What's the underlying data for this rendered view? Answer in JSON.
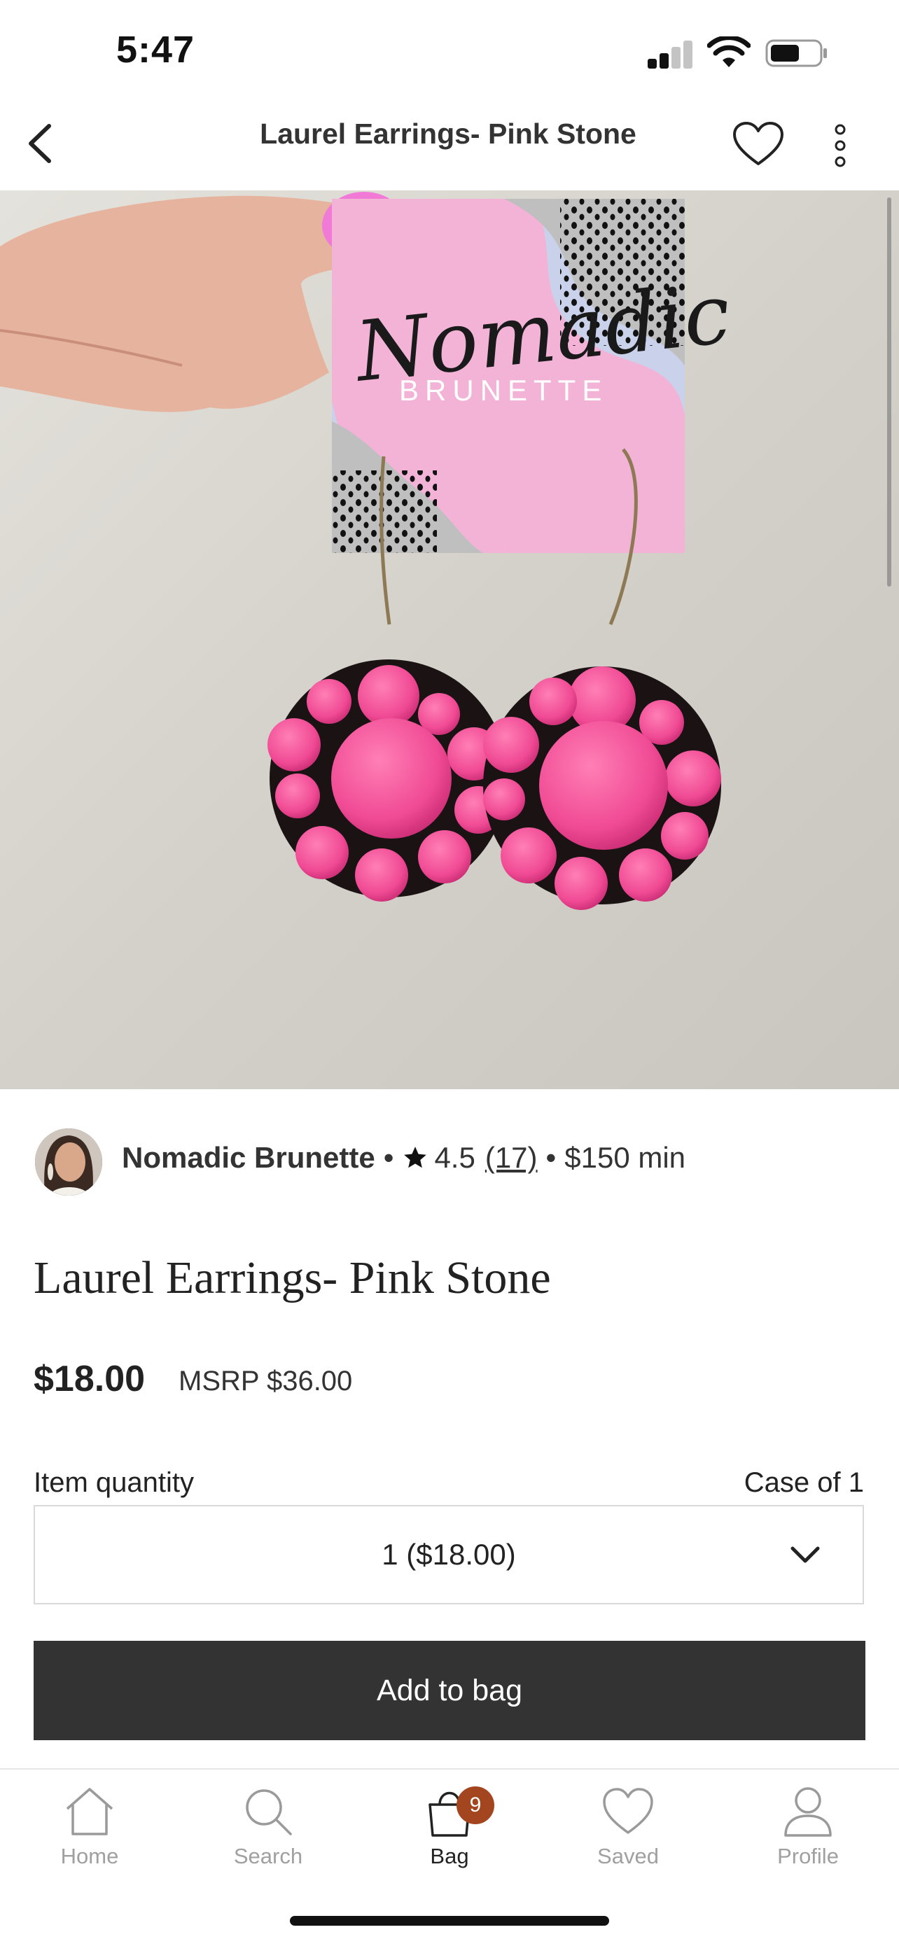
{
  "status_bar": {
    "time": "5:47"
  },
  "nav": {
    "title": "Laurel Earrings- Pink Stone"
  },
  "product_image": {
    "card_brand_script": "Nomadic",
    "card_brand_caps": "BRUNETTE"
  },
  "shop": {
    "name": "Nomadic Brunette",
    "separator": "•",
    "rating": "4.5",
    "review_count": "(17)",
    "minimum": "$150 min"
  },
  "product": {
    "title": "Laurel Earrings- Pink Stone",
    "price": "$18.00",
    "msrp": "MSRP $36.00"
  },
  "quantity": {
    "label": "Item quantity",
    "case_label": "Case of 1",
    "selected": "1 ($18.00)"
  },
  "actions": {
    "add_to_bag": "Add to bag"
  },
  "tabbar": {
    "items": [
      {
        "label": "Home"
      },
      {
        "label": "Search"
      },
      {
        "label": "Bag",
        "badge": "9"
      },
      {
        "label": "Saved"
      },
      {
        "label": "Profile"
      }
    ]
  },
  "colors": {
    "button_bg": "#333333",
    "badge_bg": "#a3451f",
    "earring_pink": "#f04a94",
    "card_pink": "#f2b3d6",
    "card_blue": "#c9d2ea"
  }
}
